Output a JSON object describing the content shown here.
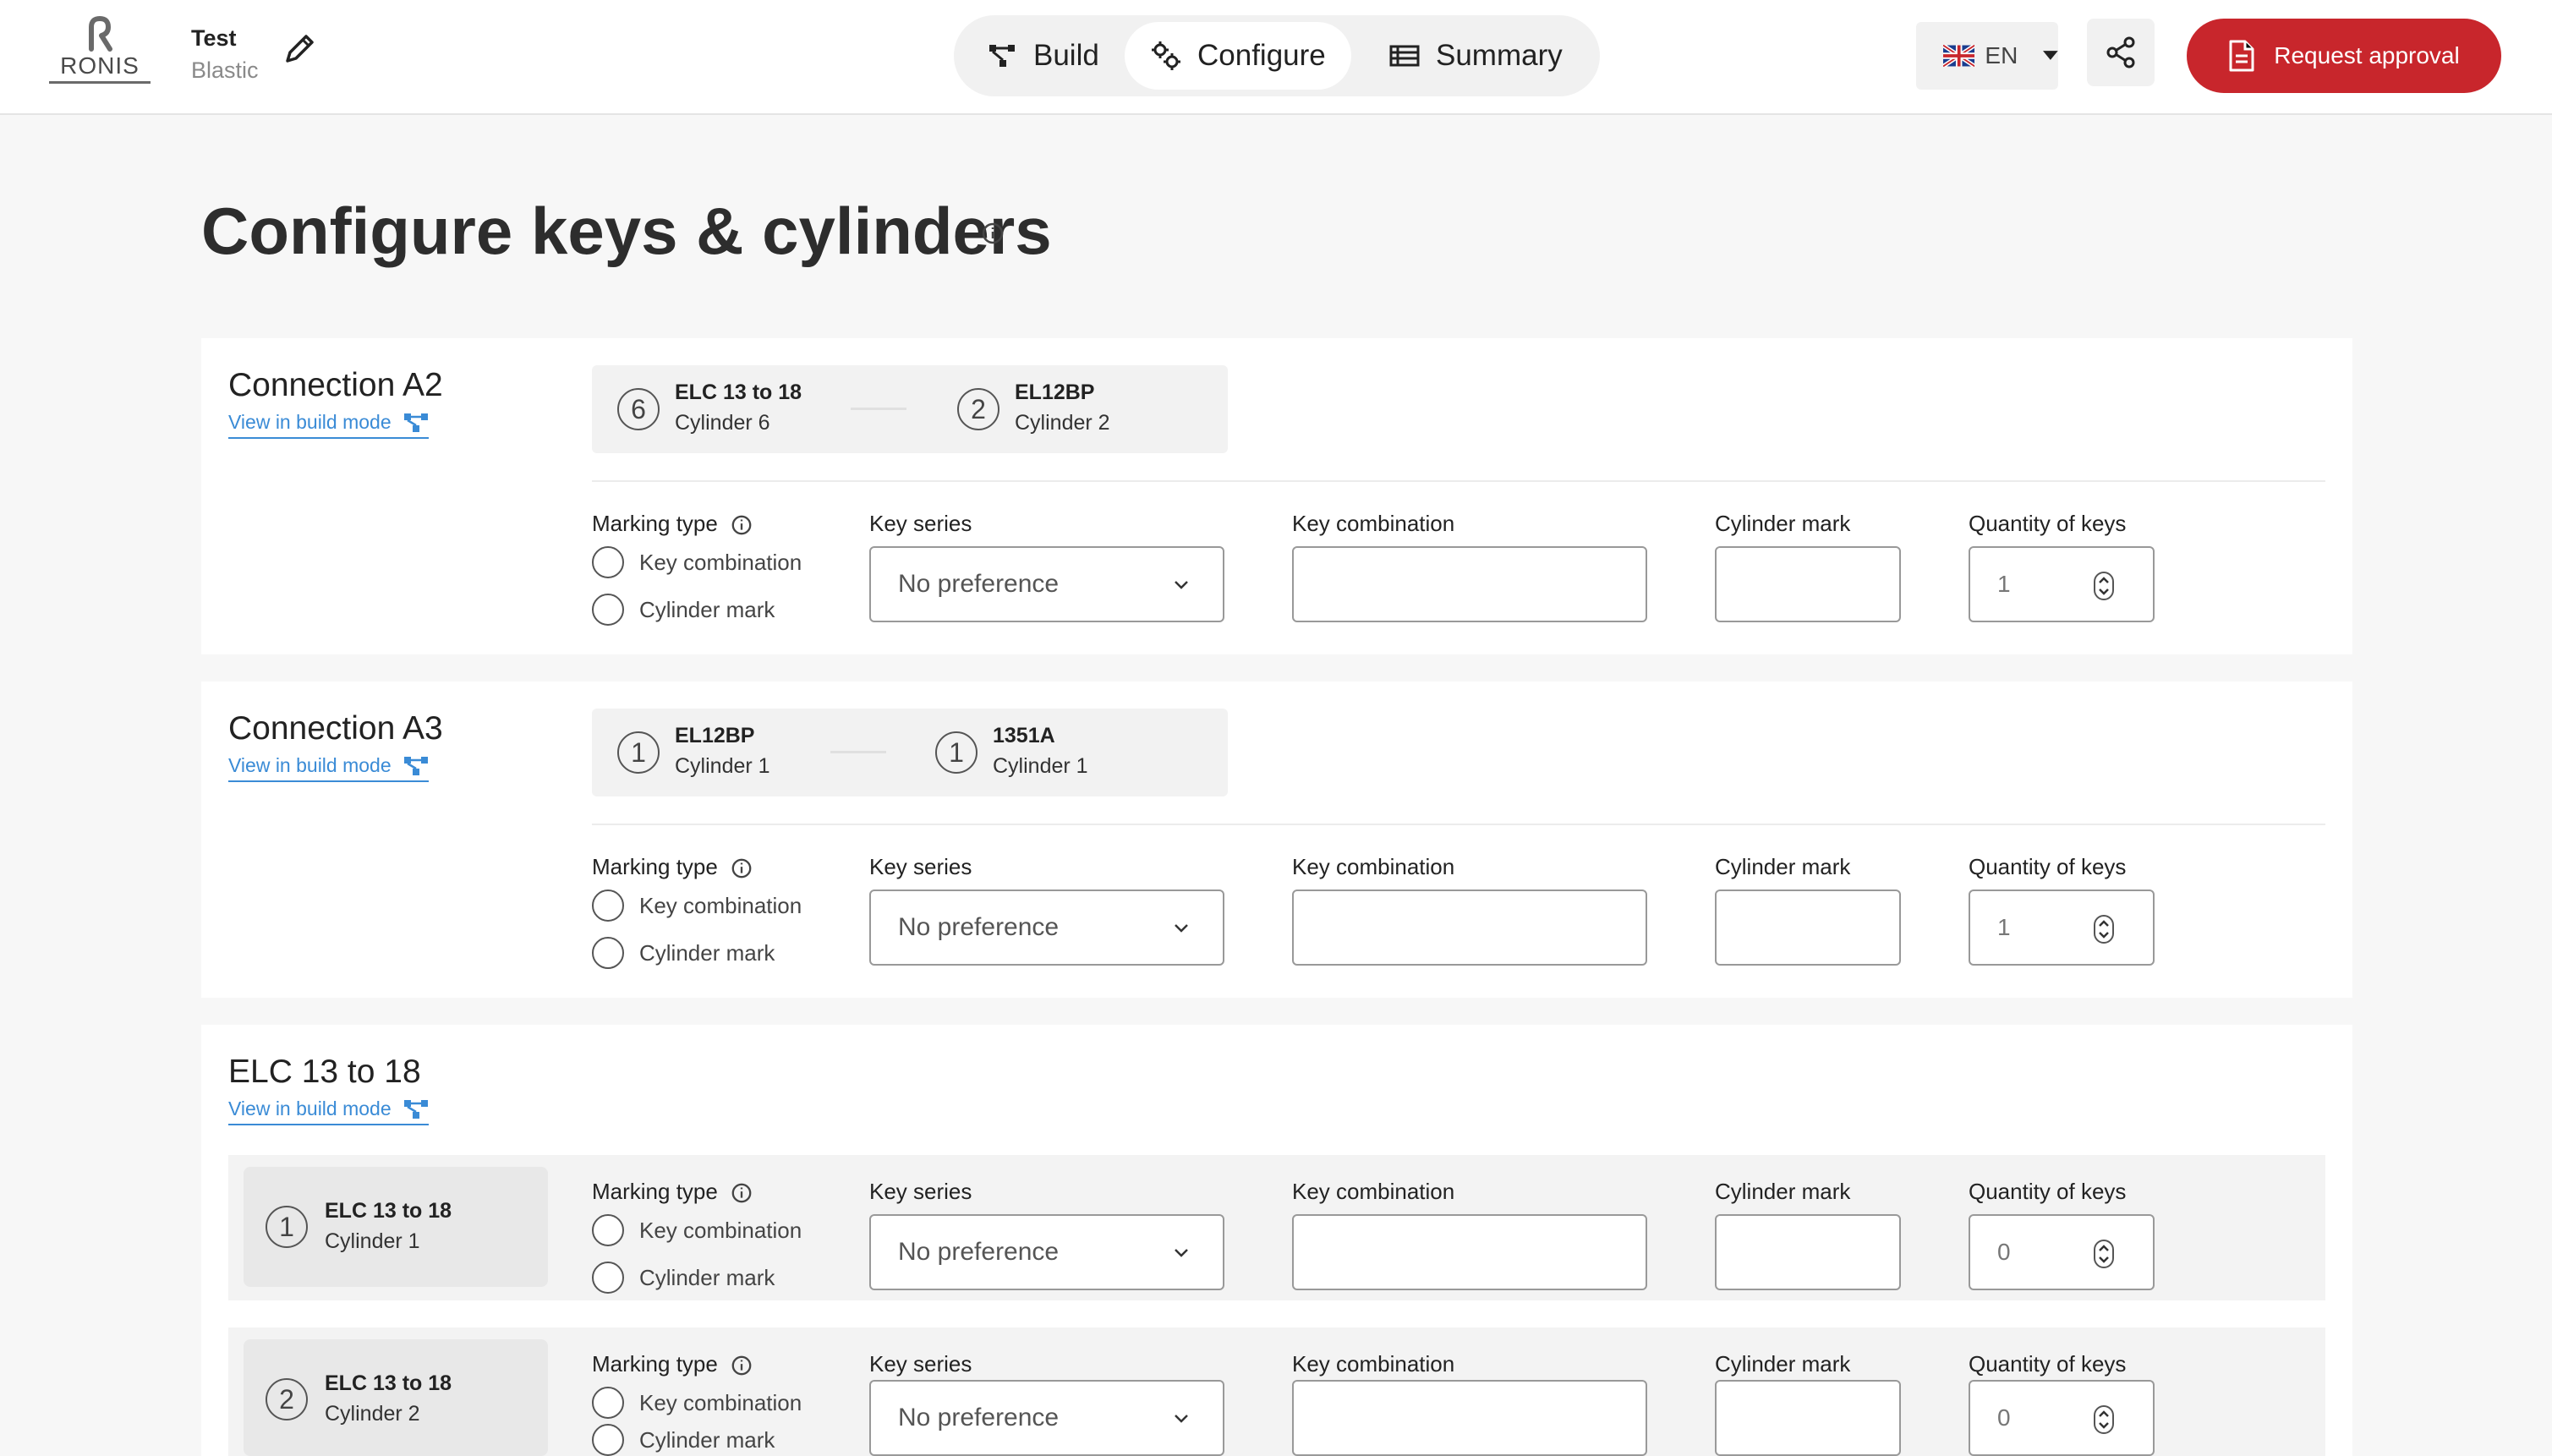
{
  "header": {
    "logo_text": "RONIS",
    "project_name": "Test",
    "project_sub": "Blastic",
    "tabs": [
      {
        "label": "Build",
        "icon": "build-icon"
      },
      {
        "label": "Configure",
        "icon": "configure-icon"
      },
      {
        "label": "Summary",
        "icon": "summary-icon"
      }
    ],
    "active_tab": "Configure",
    "language": "EN",
    "request_label": "Request approval"
  },
  "page": {
    "title": "Configure keys & cylinders",
    "view_link": "View in build mode"
  },
  "labels": {
    "marking_type": "Marking type",
    "key_combination_radio": "Key combination",
    "cylinder_mark_radio": "Cylinder mark",
    "key_series": "Key series",
    "key_combination": "Key combination",
    "cylinder_mark": "Cylinder mark",
    "quantity": "Quantity of keys"
  },
  "sections": [
    {
      "title": "Connection A2",
      "pair": [
        {
          "num": "6",
          "name": "ELC 13 to 18",
          "cyl": "Cylinder 6"
        },
        {
          "num": "2",
          "name": "EL12BP",
          "cyl": "Cylinder 2"
        }
      ],
      "key_series": "No preference",
      "quantity": "1"
    },
    {
      "title": "Connection A3",
      "pair": [
        {
          "num": "1",
          "name": "EL12BP",
          "cyl": "Cylinder 1"
        },
        {
          "num": "1",
          "name": "1351A",
          "cyl": "Cylinder 1"
        }
      ],
      "key_series": "No preference",
      "quantity": "1"
    },
    {
      "title": "ELC 13 to 18",
      "cylinders": [
        {
          "num": "1",
          "name": "ELC 13 to 18",
          "cyl": "Cylinder 1",
          "key_series": "No preference",
          "quantity": "0"
        },
        {
          "num": "2",
          "name": "ELC 13 to 18",
          "cyl": "Cylinder 2",
          "key_series": "No preference",
          "quantity": "0"
        }
      ]
    }
  ],
  "colors": {
    "accent": "#c8262c",
    "link": "#3a8bd6"
  }
}
